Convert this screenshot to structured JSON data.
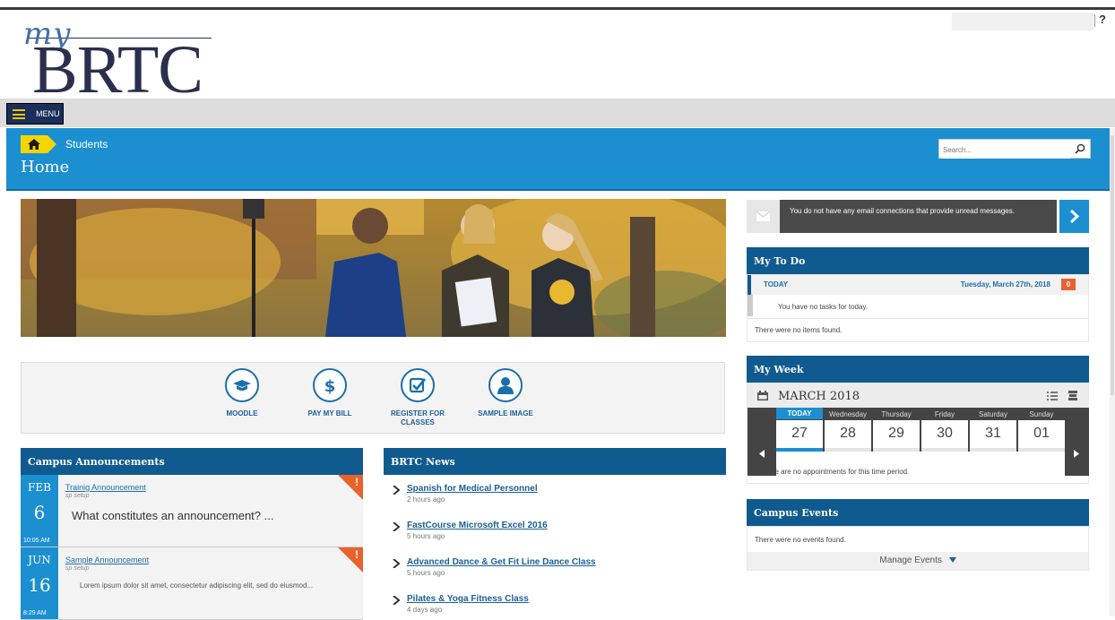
{
  "brand": {
    "my": "my",
    "name": "BRTC"
  },
  "topbar": {
    "help": "?"
  },
  "menu": {
    "label": "MENU"
  },
  "header": {
    "crumb": "Students",
    "title": "Home",
    "search_placeholder": "Search..."
  },
  "quick_links": [
    {
      "label": "MOODLE",
      "icon": "graduation-cap-icon"
    },
    {
      "label": "PAY MY BILL",
      "icon": "dollar-icon"
    },
    {
      "label": "REGISTER FOR CLASSES",
      "icon": "checkbox-icon"
    },
    {
      "label": "SAMPLE IMAGE",
      "icon": "person-icon"
    }
  ],
  "announcements": {
    "title": "Campus Announcements",
    "items": [
      {
        "month": "FEB",
        "day": "6",
        "time": "10:05 AM",
        "title": "Trainig Announcement",
        "by": "sp setup",
        "body": "What constitutes an announcement? ..."
      },
      {
        "month": "JUN",
        "day": "16",
        "time": "8:29 AM",
        "title": "Sample Announcement",
        "by": "sp setup",
        "body": "Lorem ipsum dolor sit amet, consectetur adipiscing elit, sed do eiusmod..."
      }
    ]
  },
  "news": {
    "title": "BRTC News",
    "items": [
      {
        "title": "Spanish for Medical Personnel",
        "age": "2 hours ago"
      },
      {
        "title": "FastCourse Microsoft Excel 2016",
        "age": "5 hours ago"
      },
      {
        "title": "Advanced Dance & Get Fit Line Dance Class",
        "age": "5 hours ago"
      },
      {
        "title": "Pilates & Yoga Fitness Class",
        "age": "4 days ago"
      }
    ]
  },
  "email": {
    "message": "You do not have any email connections that provide unread messages."
  },
  "todo": {
    "title": "My To Do",
    "today_label": "TODAY",
    "date": "Tuesday, March 27th, 2018",
    "count": "0",
    "empty_tasks": "You have no tasks for today.",
    "empty_items": "There were no items found."
  },
  "week": {
    "title": "My Week",
    "month": "MARCH 2018",
    "days": [
      {
        "name": "TODAY",
        "num": "27"
      },
      {
        "name": "Wednesday",
        "num": "28"
      },
      {
        "name": "Thursday",
        "num": "29"
      },
      {
        "name": "Friday",
        "num": "30"
      },
      {
        "name": "Saturday",
        "num": "31"
      },
      {
        "name": "Sunday",
        "num": "01"
      }
    ],
    "empty": "There are no appointments for this time period."
  },
  "events": {
    "title": "Campus Events",
    "empty": "There were no events found.",
    "manage": "Manage Events"
  },
  "colors": {
    "header_blue": "#1b8fd0",
    "panel_navy": "#0f5a8e",
    "menu_navy": "#1a2e5a",
    "accent_yellow": "#f5d400",
    "alert_orange": "#e8622c"
  }
}
